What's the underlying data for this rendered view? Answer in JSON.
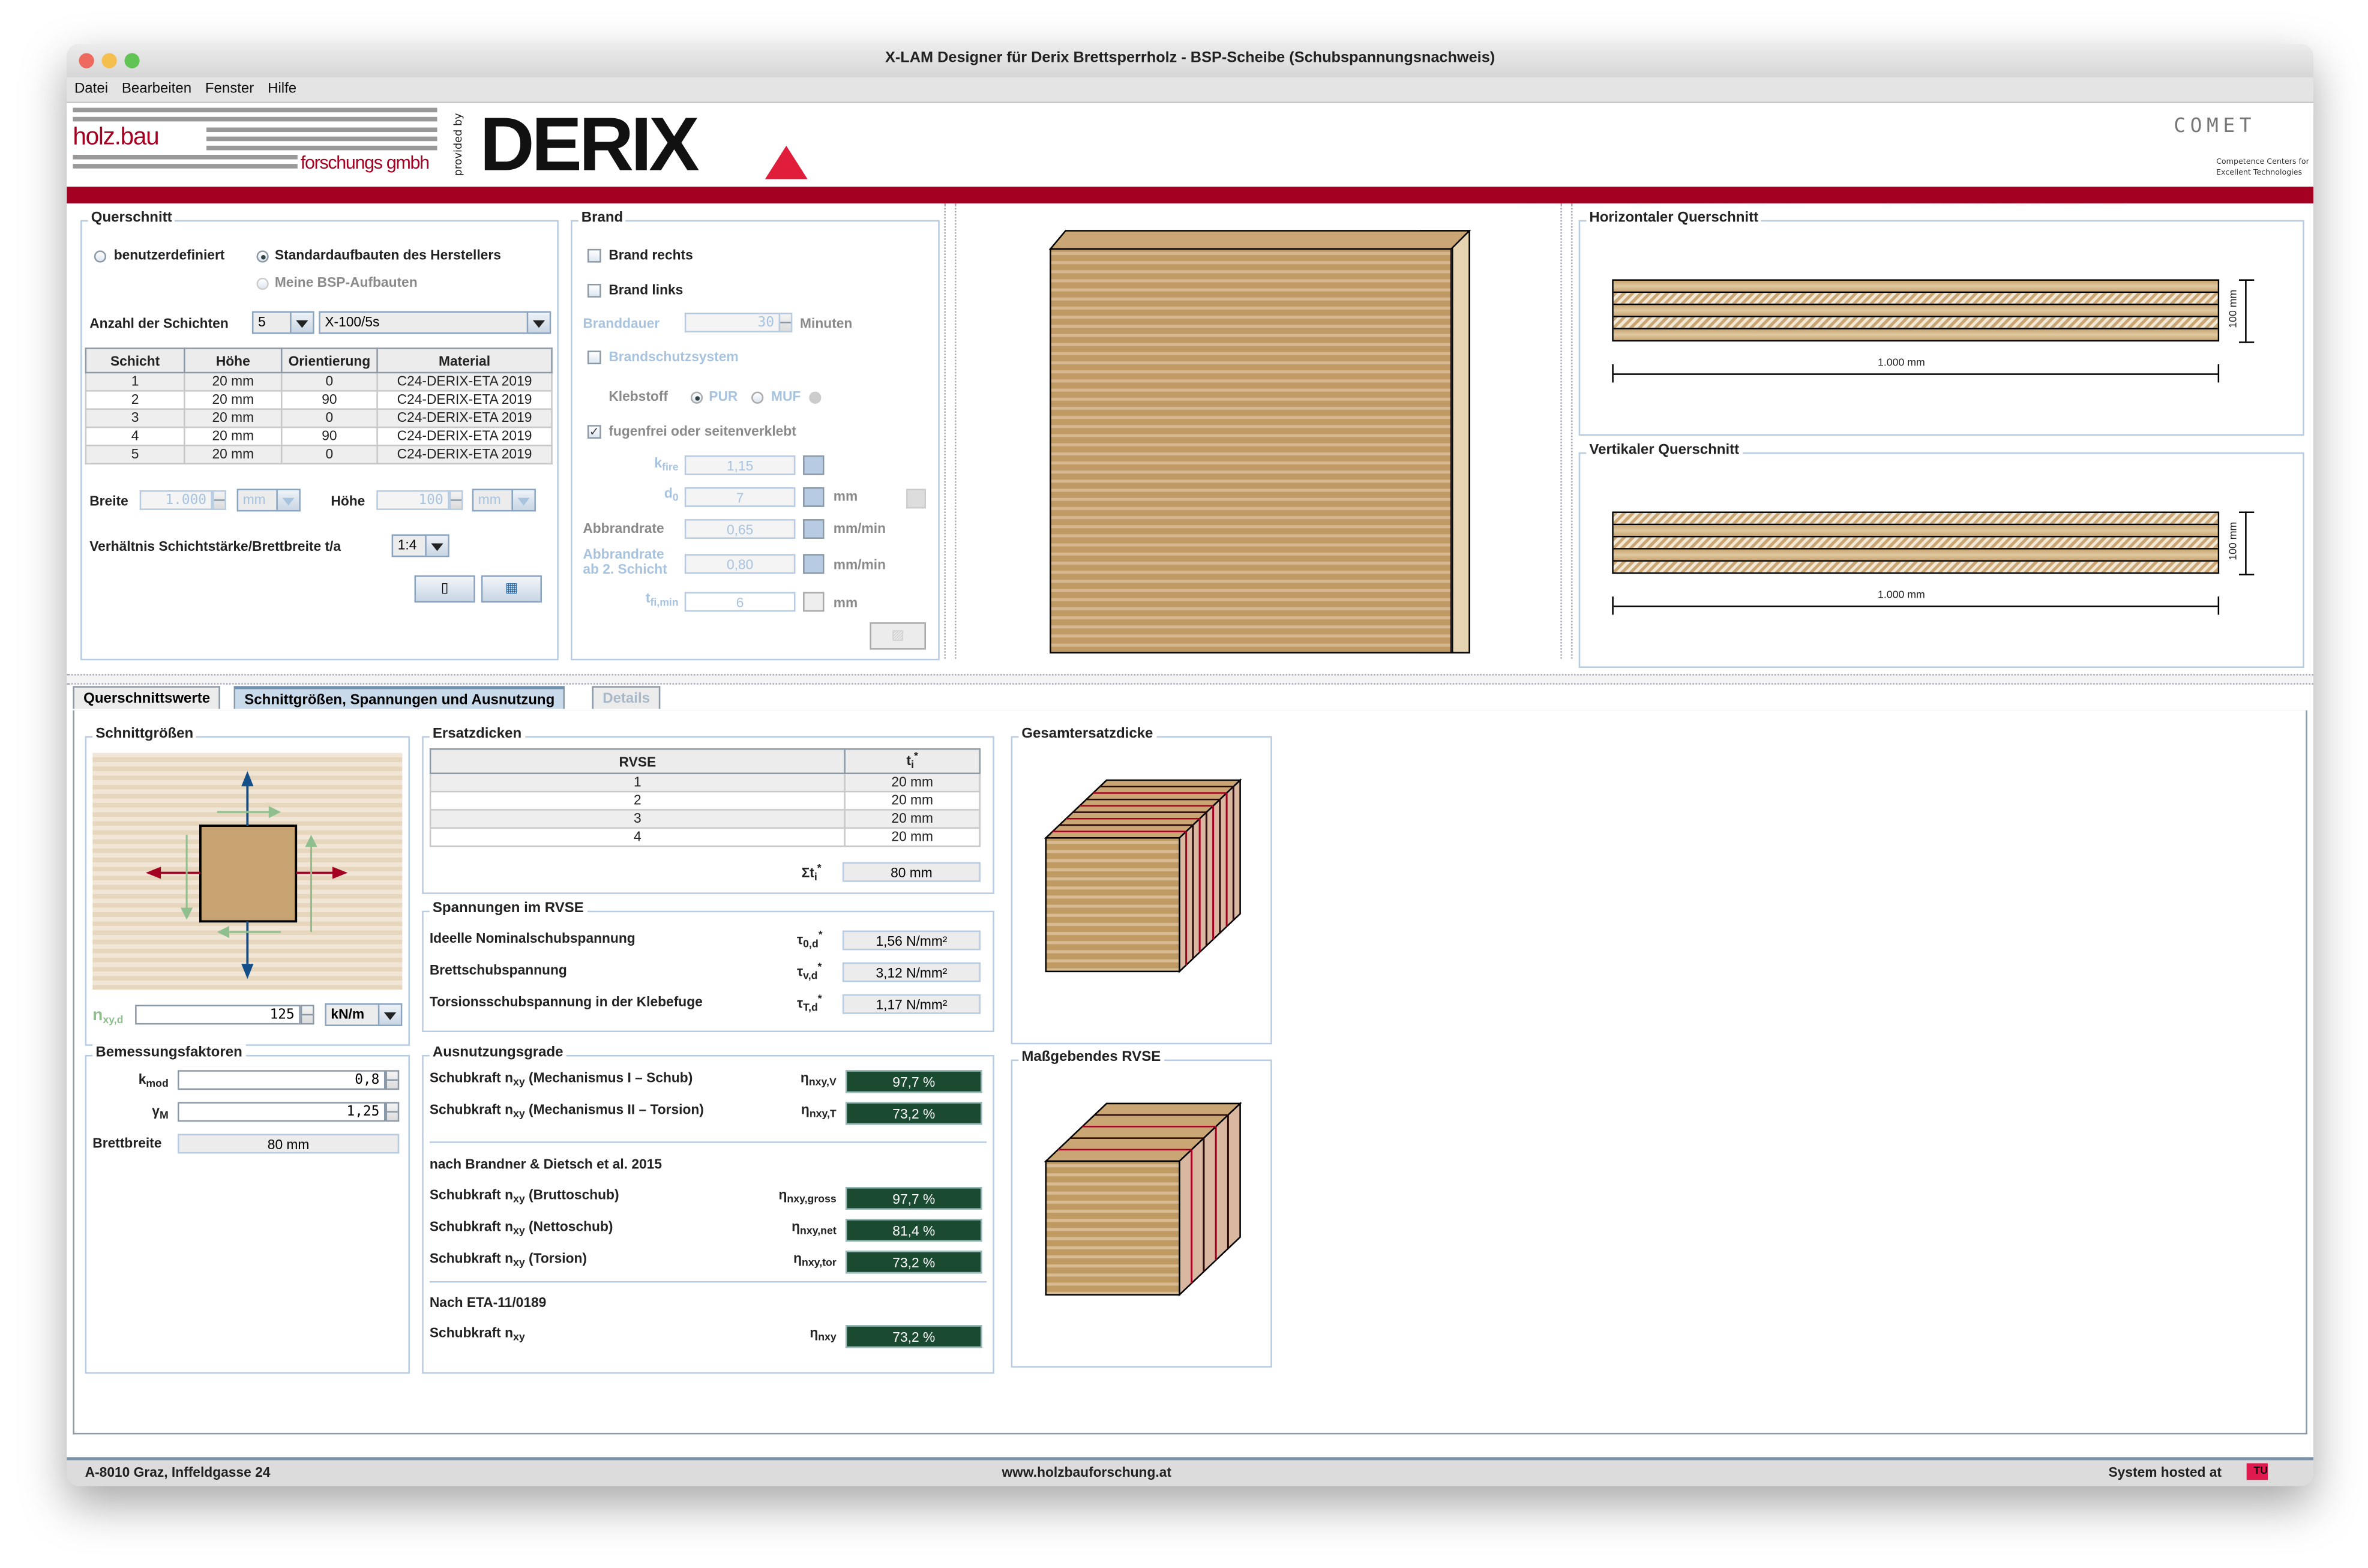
{
  "window": {
    "title": "X-LAM Designer für Derix Brettsperrholz - BSP-Scheibe (Schubspannungsnachweis)",
    "traffic_lights": {
      "close": "#ee6a5f",
      "minimize": "#f5bf4f",
      "zoom": "#61c454"
    }
  },
  "menu": [
    "Datei",
    "Bearbeiten",
    "Fenster",
    "Hilfe"
  ],
  "banner": {
    "holzbau_logo_top": "holz.bau",
    "holzbau_logo_bottom": "forschungs gmbh",
    "provided_by": "provided by",
    "derix_logo": "DERIX",
    "comet_logo": "COMET",
    "comet_sub1": "Competence Centers for",
    "comet_sub2": "Excellent Technologies",
    "brand_color": "#a30022",
    "toolbar_icons": [
      "save-icon",
      "save-as-icon",
      "document-icon",
      "run-icon",
      "checklist-icon",
      "info-icon",
      "help-icon",
      "disabled-tool-icon"
    ],
    "languages": [
      {
        "code": "de",
        "selected": true
      },
      {
        "code": "en",
        "selected": false
      },
      {
        "code": "fr",
        "selected": false
      },
      {
        "code": "it",
        "selected": false
      },
      {
        "code": "es",
        "selected": false
      },
      {
        "code": "nl",
        "selected": false
      }
    ]
  },
  "querschnitt": {
    "title": "Querschnitt",
    "radio_custom": "benutzerdefiniert",
    "radio_standard": "Standardaufbauten des Herstellers",
    "radio_mine": "Meine BSP-Aufbauten",
    "selected_radio": "standard",
    "layers_label": "Anzahl der Schichten",
    "layers_value": "5",
    "product_value": "X-100/5s",
    "table": {
      "headers": [
        "Schicht",
        "Höhe",
        "Orientierung",
        "Material"
      ],
      "rows": [
        [
          "1",
          "20 mm",
          "0",
          "C24-DERIX-ETA 2019"
        ],
        [
          "2",
          "20 mm",
          "90",
          "C24-DERIX-ETA 2019"
        ],
        [
          "3",
          "20 mm",
          "0",
          "C24-DERIX-ETA 2019"
        ],
        [
          "4",
          "20 mm",
          "90",
          "C24-DERIX-ETA 2019"
        ],
        [
          "5",
          "20 mm",
          "0",
          "C24-DERIX-ETA 2019"
        ]
      ]
    },
    "width_label": "Breite",
    "width_value": "1.000",
    "width_unit": "mm",
    "height_label": "Höhe",
    "height_value": "100",
    "height_unit": "mm",
    "ratio_label": "Verhältnis Schichtstärke/Brettbreite t/a",
    "ratio_value": "1:4"
  },
  "brand": {
    "title": "Brand",
    "brand_right": "Brand rechts",
    "brand_right_checked": false,
    "brand_left": "Brand links",
    "brand_left_checked": false,
    "duration_label": "Branddauer",
    "duration_value": "30",
    "duration_unit": "Minuten",
    "protection_label": "Brandschutzsystem",
    "adhesive_label": "Klebstoff",
    "adhesive_pur": "PUR",
    "adhesive_muf": "MUF",
    "adhesive_selected": "PUR",
    "joint_label": "fugenfrei oder seitenverklebt",
    "joint_checked": true,
    "kfire_label": "k",
    "kfire_sub": "fire",
    "kfire_value": "1,15",
    "d0_label": "d",
    "d0_sub": "0",
    "d0_value": "7",
    "d0_unit": "mm",
    "rate_label": "Abbrandrate",
    "rate_value": "0,65",
    "rate_unit": "mm/min",
    "rate2_label_1": "Abbrandrate",
    "rate2_label_2": "ab 2. Schicht",
    "rate2_value": "0,80",
    "rate2_unit": "mm/min",
    "tfi_label": "t",
    "tfi_sub": "fi,min",
    "tfi_value": "6",
    "tfi_unit": "mm"
  },
  "cross_sections": {
    "horizontal_title": "Horizontaler Querschnitt",
    "vertical_title": "Vertikaler Querschnitt",
    "width_dim": "1.000 mm",
    "height_dim": "100 mm",
    "horizontal_layers": [
      "long",
      "cross",
      "long",
      "cross",
      "long"
    ],
    "vertical_layers": [
      "cross",
      "long",
      "cross",
      "long",
      "cross"
    ]
  },
  "tabs": [
    {
      "label": "Querschnittswerte",
      "state": "normal"
    },
    {
      "label": "Schnittgrößen, Spannungen und Ausnutzung",
      "state": "active"
    },
    {
      "label": "Details",
      "state": "disabled"
    }
  ],
  "schnittgroessen": {
    "title": "Schnittgrößen",
    "nxy_label": "n",
    "nxy_sub": "xy,d",
    "nxy_value": "125",
    "nxy_unit": "kN/m"
  },
  "bemessung": {
    "title": "Bemessungsfaktoren",
    "kmod_label": "k",
    "kmod_sub": "mod",
    "kmod_value": "0,8",
    "gamma_label": "γ",
    "gamma_sub": "M",
    "gamma_value": "1,25",
    "brett_label": "Brettbreite",
    "brett_value": "80 mm"
  },
  "ersatzdicken": {
    "title": "Ersatzdicken",
    "headers": [
      "RVSE",
      "t"
    ],
    "header_t_sub": "i",
    "header_t_sup": "*",
    "rows": [
      [
        "1",
        "20 mm"
      ],
      [
        "2",
        "20 mm"
      ],
      [
        "3",
        "20 mm"
      ],
      [
        "4",
        "20 mm"
      ]
    ],
    "sum_label": "Σt",
    "sum_value": "80 mm"
  },
  "spannungen": {
    "title": "Spannungen im RVSE",
    "rows": [
      {
        "label": "Ideelle Nominalschubspannung",
        "symbol": "τ",
        "sub": "0,d",
        "value": "1,56 N/mm²"
      },
      {
        "label": "Brettschubspannung",
        "symbol": "τ",
        "sub": "v,d",
        "value": "3,12 N/mm²"
      },
      {
        "label": "Torsionsschubspannung in der Klebefuge",
        "symbol": "τ",
        "sub": "T,d",
        "value": "1,17 N/mm²"
      }
    ]
  },
  "ausnutzung": {
    "title": "Ausnutzungsgrade",
    "bar_color": "#1a4a30",
    "group1": [
      {
        "label_pre": "Schubkraft n",
        "label_sub": "xy",
        "label_post": " (Mechanismus I – Schub)",
        "symbol_sub": "nxy,V",
        "value": "97,7 %"
      },
      {
        "label_pre": "Schubkraft n",
        "label_sub": "xy",
        "label_post": " (Mechanismus II – Torsion)",
        "symbol_sub": "nxy,T",
        "value": "73,2 %"
      }
    ],
    "group2_title": "nach Brandner & Dietsch et al. 2015",
    "group2": [
      {
        "label_pre": "Schubkraft n",
        "label_sub": "xy",
        "label_post": " (Bruttoschub)",
        "symbol_sub": "nxy,gross",
        "value": "97,7 %"
      },
      {
        "label_pre": "Schubkraft n",
        "label_sub": "xy",
        "label_post": " (Nettoschub)",
        "symbol_sub": "nxy,net",
        "value": "81,4 %"
      },
      {
        "label_pre": "Schubkraft n",
        "label_sub": "xy",
        "label_post": " (Torsion)",
        "symbol_sub": "nxy,tor",
        "value": "73,2 %"
      }
    ],
    "group3_title": "Nach ETA-11/0189",
    "group3": [
      {
        "label_pre": "Schubkraft n",
        "label_sub": "xy",
        "label_post": "",
        "symbol_sub": "nxy",
        "value": "73,2 %"
      }
    ],
    "symbol": "η"
  },
  "graphics": {
    "gesamt_title": "Gesamtersatzdicke",
    "massgebend_title": "Maßgebendes RVSE"
  },
  "footer": {
    "address": "A-8010 Graz, Inffeldgasse 24",
    "website": "www.holzbauforschung.at",
    "hosted": "System hosted at",
    "hosted_logo": "TU"
  }
}
